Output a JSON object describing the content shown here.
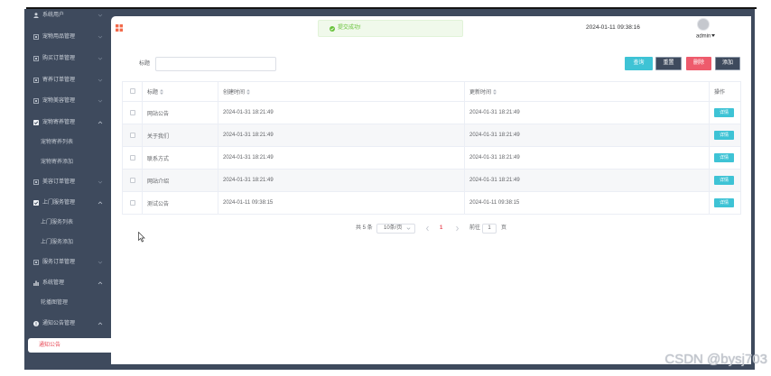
{
  "app": {
    "alert": "提交成功!",
    "datetime": "2024-01-11 09:38:16",
    "username": "admin"
  },
  "sidebar": {
    "items": [
      {
        "label": "系统用户",
        "icon": "user-icon",
        "expanded": false
      },
      {
        "label": "宠物用品管理",
        "icon": "menu-square-icon",
        "expanded": false
      },
      {
        "label": "购买订单管理",
        "icon": "menu-square-icon",
        "expanded": false
      },
      {
        "label": "寄养订单管理",
        "icon": "menu-square-icon",
        "expanded": false
      },
      {
        "label": "宠物美容管理",
        "icon": "menu-square-icon",
        "expanded": false
      },
      {
        "label": "宠物寄养管理",
        "icon": "checked-square-icon",
        "expanded": true
      },
      {
        "label": "宠物寄养列表",
        "sub": true
      },
      {
        "label": "宠物寄养添加",
        "sub": true
      },
      {
        "label": "美容订单管理",
        "icon": "menu-square-icon",
        "expanded": false
      },
      {
        "label": "上门服务管理",
        "icon": "checked-square-icon",
        "expanded": true
      },
      {
        "label": "上门服务列表",
        "sub": true
      },
      {
        "label": "上门服务添加",
        "sub": true
      },
      {
        "label": "服务订单管理",
        "icon": "menu-square-icon",
        "expanded": false
      },
      {
        "label": "系统管理",
        "icon": "bar-chart-icon",
        "expanded": true
      },
      {
        "label": "轮播图管理",
        "sub": true
      },
      {
        "label": "通知公告管理",
        "icon": "info-circle-icon",
        "expanded": true
      },
      {
        "label": "通知公告",
        "sub": true,
        "active": true
      }
    ]
  },
  "search": {
    "label": "标题",
    "value": "",
    "buttons": {
      "query": "查询",
      "reset": "重置",
      "delete": "删除",
      "add": "添加"
    }
  },
  "table": {
    "columns": [
      "标题",
      "创建时间",
      "更新时间",
      "操作"
    ],
    "action_label": "详情",
    "rows": [
      {
        "title": "网站公告",
        "created": "2024-01-31 18:21:49",
        "updated": "2024-01-31 18:21:49"
      },
      {
        "title": "关于我们",
        "created": "2024-01-31 18:21:49",
        "updated": "2024-01-31 18:21:49"
      },
      {
        "title": "联系方式",
        "created": "2024-01-31 18:21:49",
        "updated": "2024-01-31 18:21:49"
      },
      {
        "title": "网站介绍",
        "created": "2024-01-31 18:21:49",
        "updated": "2024-01-31 18:21:49"
      },
      {
        "title": "测试公告",
        "created": "2024-01-11 09:38:15",
        "updated": "2024-01-11 09:38:15"
      }
    ]
  },
  "pagination": {
    "total": "共 5 条",
    "page_size": "10条/页",
    "current": "1",
    "goto_prefix": "前往",
    "goto_value": "1",
    "goto_suffix": "页"
  },
  "watermark": "CSDN @bysj703",
  "colors": {
    "sidebar_bg": "#3e4a5d",
    "accent_teal": "#3ec3d5",
    "danger": "#ee5b6c",
    "active_text": "#e84a57",
    "success": "#67c23a"
  }
}
